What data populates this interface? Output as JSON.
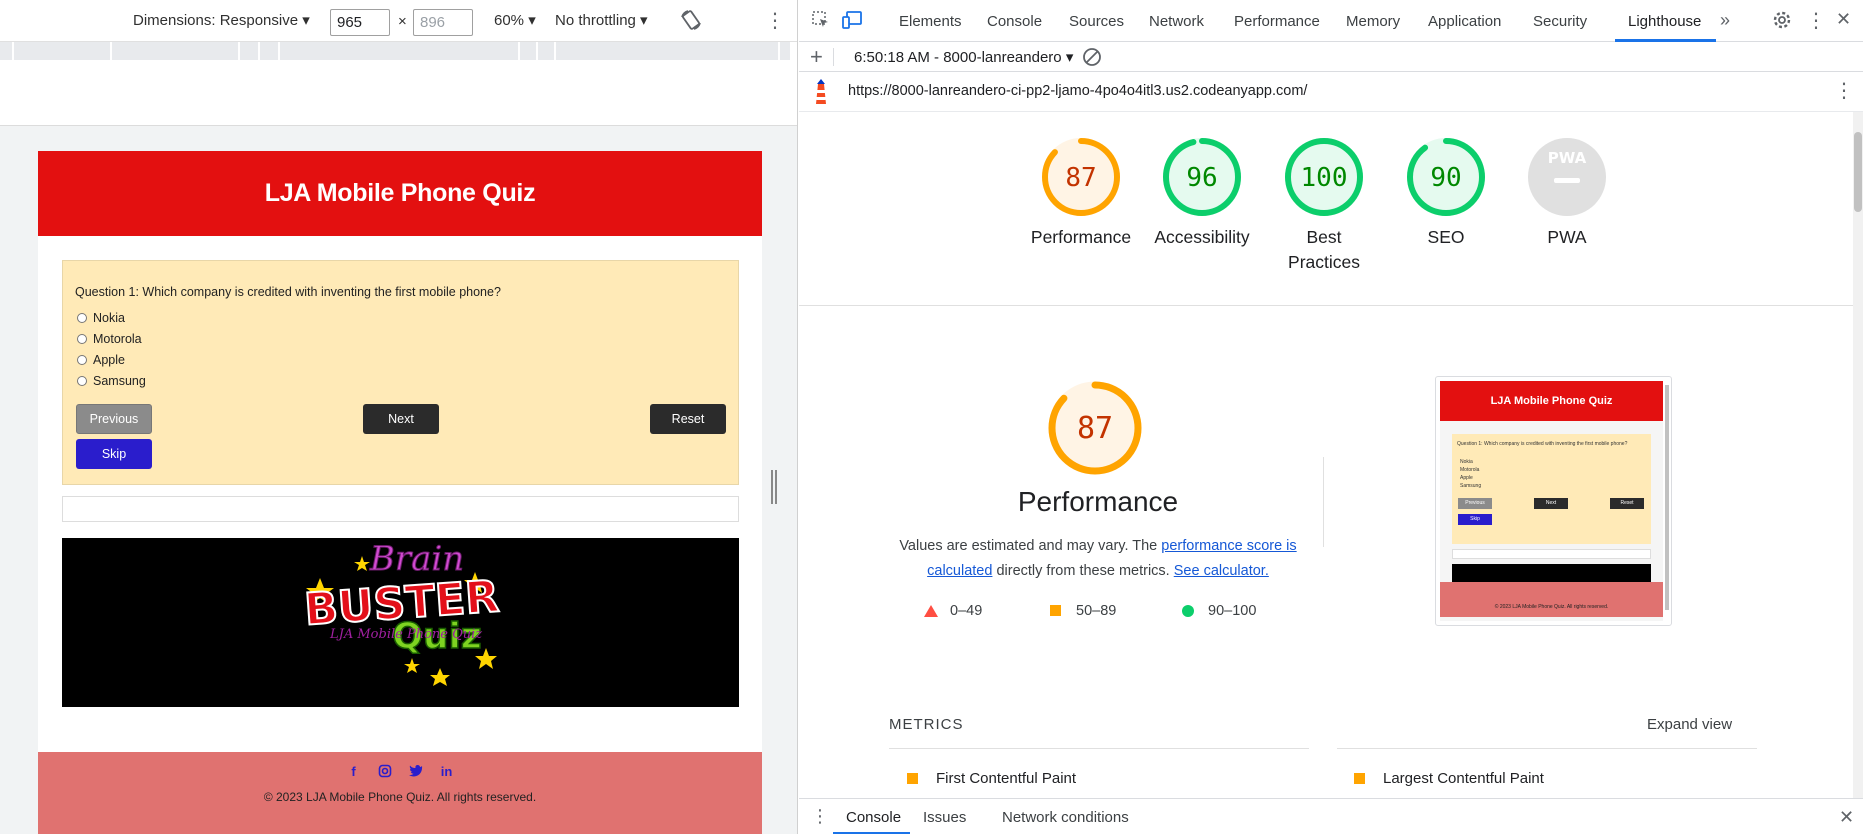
{
  "device_toolbar": {
    "dimensions_label": "Dimensions: Responsive",
    "width_value": "965",
    "times": "×",
    "height_placeholder": "896",
    "zoom": "60%",
    "throttling": "No throttling"
  },
  "quiz": {
    "title": "LJA Mobile Phone Quiz",
    "question": "Question 1: Which company is credited with inventing the first mobile phone?",
    "options": [
      "Nokia",
      "Motorola",
      "Apple",
      "Samsung"
    ],
    "buttons": {
      "previous": "Previous",
      "next": "Next",
      "reset": "Reset",
      "skip": "Skip"
    },
    "banner": {
      "line1": "Brain",
      "line2": "BUSTER",
      "line3": "Quiz",
      "side": "LJA Mobile Phone Quiz"
    },
    "footer": {
      "copyright": "© 2023 LJA Mobile Phone Quiz. All rights reserved.",
      "social_icons": [
        "facebook-icon",
        "instagram-icon",
        "twitter-icon",
        "linkedin-icon"
      ]
    }
  },
  "devtools": {
    "tabs": [
      "Elements",
      "Console",
      "Sources",
      "Network",
      "Performance",
      "Memory",
      "Application",
      "Security",
      "Lighthouse"
    ],
    "active_tab": "Lighthouse",
    "report_selector": "6:50:18 AM - 8000-lanreandero",
    "url": "https://8000-lanreandero-ci-pp2-ljamo-4po4o4itl3.us2.codeanyapp.com/"
  },
  "scores": [
    {
      "label": "Performance",
      "value": "87",
      "score": 87,
      "color": "#ffa400",
      "text_color": "#c33300"
    },
    {
      "label": "Accessibility",
      "value": "96",
      "score": 96,
      "color": "#0cce6b",
      "text_color": "#008800"
    },
    {
      "label": "Best Practices",
      "value": "100",
      "score": 100,
      "color": "#0cce6b",
      "text_color": "#008800"
    },
    {
      "label": "SEO",
      "value": "90",
      "score": 90,
      "color": "#0cce6b",
      "text_color": "#008800"
    },
    {
      "label": "PWA",
      "value": "PWA",
      "score": 0,
      "color": "#e0e0e0",
      "text_color": "#ffffff"
    }
  ],
  "performance": {
    "score": "87",
    "title": "Performance",
    "desc_prefix": "Values are estimated and may vary. The ",
    "desc_link1": "performance score is calculated",
    "desc_middle": " directly from these metrics. ",
    "desc_link2": "See calculator.",
    "legend": [
      {
        "range": "0–49",
        "shape": "triangle",
        "color": "#ff4e42"
      },
      {
        "range": "50–89",
        "shape": "square",
        "color": "#ffa400"
      },
      {
        "range": "90–100",
        "shape": "circle",
        "color": "#0cce6b"
      }
    ],
    "thumbnail": {
      "title": "LJA Mobile Phone Quiz",
      "question": "Question 1: Which company is credited with inventing the first mobile phone?",
      "options": [
        "Nokia",
        "Motorola",
        "Apple",
        "Samsung"
      ],
      "buttons": [
        "Previous",
        "Next",
        "Reset",
        "Skip"
      ],
      "footer": "© 2023 LJA Mobile Phone Quiz. All rights reserved."
    }
  },
  "metrics": {
    "header": "METRICS",
    "expand": "Expand view",
    "items": [
      "First Contentful Paint",
      "Largest Contentful Paint"
    ]
  },
  "drawer": {
    "tabs": [
      "Console",
      "Issues",
      "Network conditions"
    ]
  }
}
